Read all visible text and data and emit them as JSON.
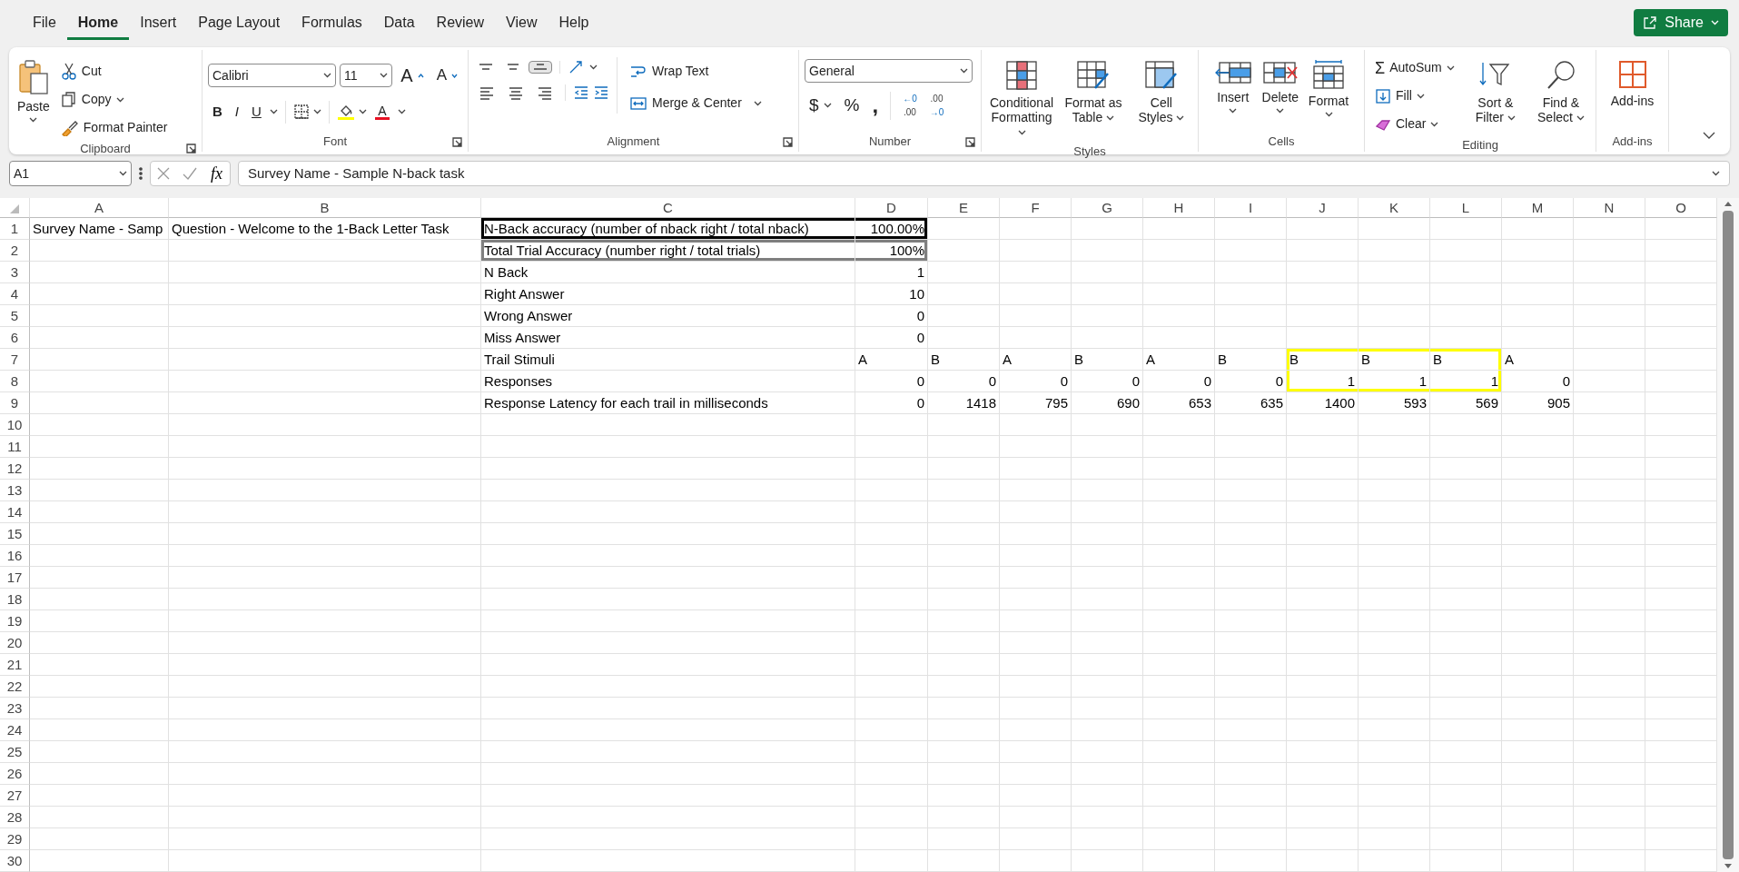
{
  "menu_tabs": [
    {
      "label": "File",
      "selected": false
    },
    {
      "label": "Home",
      "selected": true
    },
    {
      "label": "Insert",
      "selected": false
    },
    {
      "label": "Page Layout",
      "selected": false
    },
    {
      "label": "Formulas",
      "selected": false
    },
    {
      "label": "Data",
      "selected": false
    },
    {
      "label": "Review",
      "selected": false
    },
    {
      "label": "View",
      "selected": false
    },
    {
      "label": "Help",
      "selected": false
    }
  ],
  "share_button": {
    "label": "Share"
  },
  "ribbon": {
    "clipboard": {
      "title": "Clipboard",
      "dialog_launcher": true,
      "paste": {
        "label": "Paste"
      },
      "items": [
        {
          "kind": "cut",
          "label": "Cut",
          "dropdown": false
        },
        {
          "kind": "copy",
          "label": "Copy",
          "dropdown": true
        },
        {
          "kind": "painter",
          "label": "Format Painter",
          "dropdown": false
        }
      ]
    },
    "font": {
      "title": "Font",
      "dialog_launcher": true,
      "font_name": "Calibri",
      "font_size": "11",
      "size_buttons": [
        {
          "kind": "grow",
          "label": "A"
        },
        {
          "kind": "shrink",
          "label": "A"
        }
      ],
      "style_buttons": [
        {
          "kind": "bold",
          "label": "B"
        },
        {
          "kind": "italic",
          "label": "I"
        },
        {
          "kind": "underline",
          "label": "U"
        }
      ],
      "font_color_label": "A"
    },
    "alignment": {
      "title": "Alignment",
      "dialog_launcher": true,
      "vertical": [
        {
          "kind": "top",
          "selected": false
        },
        {
          "kind": "middle",
          "selected": false
        },
        {
          "kind": "bottom",
          "selected": true
        }
      ],
      "horizontal": [
        {
          "kind": "left",
          "selected": false
        },
        {
          "kind": "center",
          "selected": false
        },
        {
          "kind": "right",
          "selected": false
        }
      ],
      "wrap_text": "Wrap Text",
      "merge": "Merge & Center"
    },
    "number": {
      "title": "Number",
      "dialog_launcher": true,
      "format": "General",
      "symbols": [
        {
          "kind": "currency",
          "label": "$",
          "dropdown": true
        },
        {
          "kind": "percent",
          "label": "%",
          "dropdown": false
        },
        {
          "kind": "comma",
          "label": ",",
          "dropdown": false
        }
      ],
      "decimals": [
        {
          "kind": "increase",
          "top": "←0",
          "bottom": ".00"
        },
        {
          "kind": "decrease",
          "top": ".00",
          "bottom": "→0"
        }
      ]
    },
    "styles": {
      "title": "Styles",
      "dialog_launcher": false,
      "buttons": [
        {
          "kind": "conditional",
          "label": "Conditional Formatting"
        },
        {
          "kind": "table",
          "label": "Format as Table"
        },
        {
          "kind": "cellstyles",
          "label": "Cell Styles"
        }
      ]
    },
    "cells": {
      "title": "Cells",
      "dialog_launcher": false,
      "buttons": [
        {
          "kind": "insert",
          "label": "Insert"
        },
        {
          "kind": "delete",
          "label": "Delete"
        },
        {
          "kind": "format",
          "label": "Format"
        }
      ]
    },
    "editing": {
      "title": "Editing",
      "dialog_launcher": false,
      "autosum_symbol": "Σ",
      "small": [
        {
          "kind": "autosum",
          "label": "AutoSum"
        },
        {
          "kind": "fill",
          "label": "Fill"
        },
        {
          "kind": "clear",
          "label": "Clear"
        }
      ],
      "buttons": [
        {
          "kind": "sort",
          "label": "Sort & Filter"
        },
        {
          "kind": "find",
          "label": "Find & Select"
        }
      ]
    },
    "addins": {
      "title": "Add-ins",
      "dialog_launcher": false,
      "buttons": [
        {
          "kind": "addins",
          "label": "Add-ins"
        }
      ]
    }
  },
  "formula_bar": {
    "name_box": "A1",
    "fx": "fx",
    "formula": "Survey Name - Sample N-back task"
  },
  "sheet": {
    "columns": [
      "A",
      "B",
      "C",
      "D",
      "E",
      "F",
      "G",
      "H",
      "I",
      "J",
      "K",
      "L",
      "M",
      "N",
      "O"
    ],
    "rows": [
      {
        "label": "1",
        "cells": [
          {
            "kind": "text",
            "text": "Survey Name - Samp"
          },
          {
            "kind": "text",
            "text": "Question - Welcome to the 1-Back Letter Task"
          },
          {
            "kind": "text",
            "text": "N-Back accuracy (number of nback right / total nback)",
            "color": "#000000"
          },
          {
            "kind": "number",
            "text": "100.00%",
            "color": "#000000"
          }
        ]
      },
      {
        "label": "2",
        "cells": [
          {
            "kind": "empty"
          },
          {
            "kind": "empty"
          },
          {
            "kind": "text",
            "text": "Total Trial Accuracy (number right / total trials)",
            "color": "#7f7f7f"
          },
          {
            "kind": "number",
            "text": "100%",
            "color": "#7f7f7f"
          }
        ]
      },
      {
        "label": "3",
        "cells": [
          {
            "kind": "empty"
          },
          {
            "kind": "empty"
          },
          {
            "kind": "text",
            "text": "N Back"
          },
          {
            "kind": "number",
            "text": "1"
          }
        ]
      },
      {
        "label": "4",
        "cells": [
          {
            "kind": "empty"
          },
          {
            "kind": "empty"
          },
          {
            "kind": "text",
            "text": "Right Answer"
          },
          {
            "kind": "number",
            "text": "10"
          }
        ]
      },
      {
        "label": "5",
        "cells": [
          {
            "kind": "empty"
          },
          {
            "kind": "empty"
          },
          {
            "kind": "text",
            "text": "Wrong Answer"
          },
          {
            "kind": "number",
            "text": "0"
          }
        ]
      },
      {
        "label": "6",
        "cells": [
          {
            "kind": "empty"
          },
          {
            "kind": "empty"
          },
          {
            "kind": "text",
            "text": "Miss Answer"
          },
          {
            "kind": "number",
            "text": "0"
          }
        ]
      },
      {
        "label": "7",
        "cells": [
          {
            "kind": "empty"
          },
          {
            "kind": "empty"
          },
          {
            "kind": "text",
            "text": "Trail Stimuli"
          },
          {
            "kind": "text",
            "text": "A"
          },
          {
            "kind": "text",
            "text": "B"
          },
          {
            "kind": "text",
            "text": "A"
          },
          {
            "kind": "text",
            "text": "B"
          },
          {
            "kind": "text",
            "text": "A"
          },
          {
            "kind": "text",
            "text": "B"
          },
          {
            "kind": "text",
            "text": "B",
            "color": "#ffff00"
          },
          {
            "kind": "text",
            "text": "B",
            "color": "#ffff00"
          },
          {
            "kind": "text",
            "text": "B",
            "color": "#ffff00"
          },
          {
            "kind": "text",
            "text": "A"
          }
        ]
      },
      {
        "label": "8",
        "cells": [
          {
            "kind": "empty"
          },
          {
            "kind": "empty"
          },
          {
            "kind": "text",
            "text": "Responses"
          },
          {
            "kind": "number",
            "text": "0"
          },
          {
            "kind": "number",
            "text": "0"
          },
          {
            "kind": "number",
            "text": "0"
          },
          {
            "kind": "number",
            "text": "0"
          },
          {
            "kind": "number",
            "text": "0"
          },
          {
            "kind": "number",
            "text": "0"
          },
          {
            "kind": "number",
            "text": "1",
            "color": "#ffff00"
          },
          {
            "kind": "number",
            "text": "1",
            "color": "#ffff00"
          },
          {
            "kind": "number",
            "text": "1",
            "color": "#ffff00"
          },
          {
            "kind": "number",
            "text": "0"
          }
        ]
      },
      {
        "label": "9",
        "cells": [
          {
            "kind": "empty"
          },
          {
            "kind": "empty"
          },
          {
            "kind": "text",
            "text": "Response Latency for each trail in milliseconds"
          },
          {
            "kind": "number",
            "text": "0"
          },
          {
            "kind": "number",
            "text": "1418"
          },
          {
            "kind": "number",
            "text": "795"
          },
          {
            "kind": "number",
            "text": "690"
          },
          {
            "kind": "number",
            "text": "653"
          },
          {
            "kind": "number",
            "text": "635"
          },
          {
            "kind": "number",
            "text": "1400"
          },
          {
            "kind": "number",
            "text": "593"
          },
          {
            "kind": "number",
            "text": "569"
          },
          {
            "kind": "number",
            "text": "905"
          }
        ]
      },
      {
        "label": "10"
      },
      {
        "label": "11"
      },
      {
        "label": "12"
      },
      {
        "label": "13"
      },
      {
        "label": "14"
      },
      {
        "label": "15"
      },
      {
        "label": "16"
      },
      {
        "label": "17"
      },
      {
        "label": "18"
      },
      {
        "label": "19"
      },
      {
        "label": "20"
      },
      {
        "label": "21"
      },
      {
        "label": "22"
      },
      {
        "label": "23"
      },
      {
        "label": "24"
      },
      {
        "label": "25"
      },
      {
        "label": "26"
      },
      {
        "label": "27"
      },
      {
        "label": "28"
      },
      {
        "label": "29"
      },
      {
        "label": "30"
      }
    ]
  }
}
